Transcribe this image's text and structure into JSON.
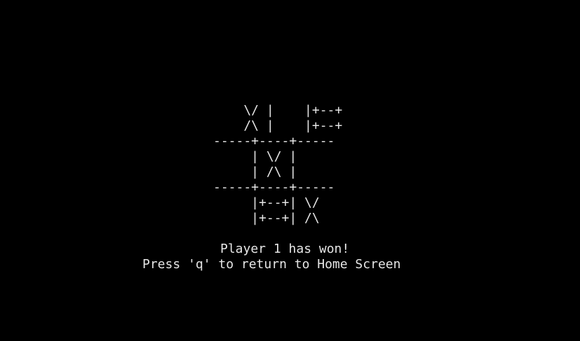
{
  "terminal": {
    "background": "#000000",
    "foreground": "#e6e6e6",
    "board": {
      "lines": [
        "    \\/ |    |+--+",
        "    /\\ |    |+--+",
        "-----+----+-----",
        "     | \\/ |",
        "     | /\\ |",
        "-----+----+-----",
        "     |+--+| \\/",
        "     |+--+| /\\"
      ]
    },
    "status": {
      "message": "Player 1 has won!",
      "instruction": "Press 'q' to return to Home Screen"
    }
  }
}
